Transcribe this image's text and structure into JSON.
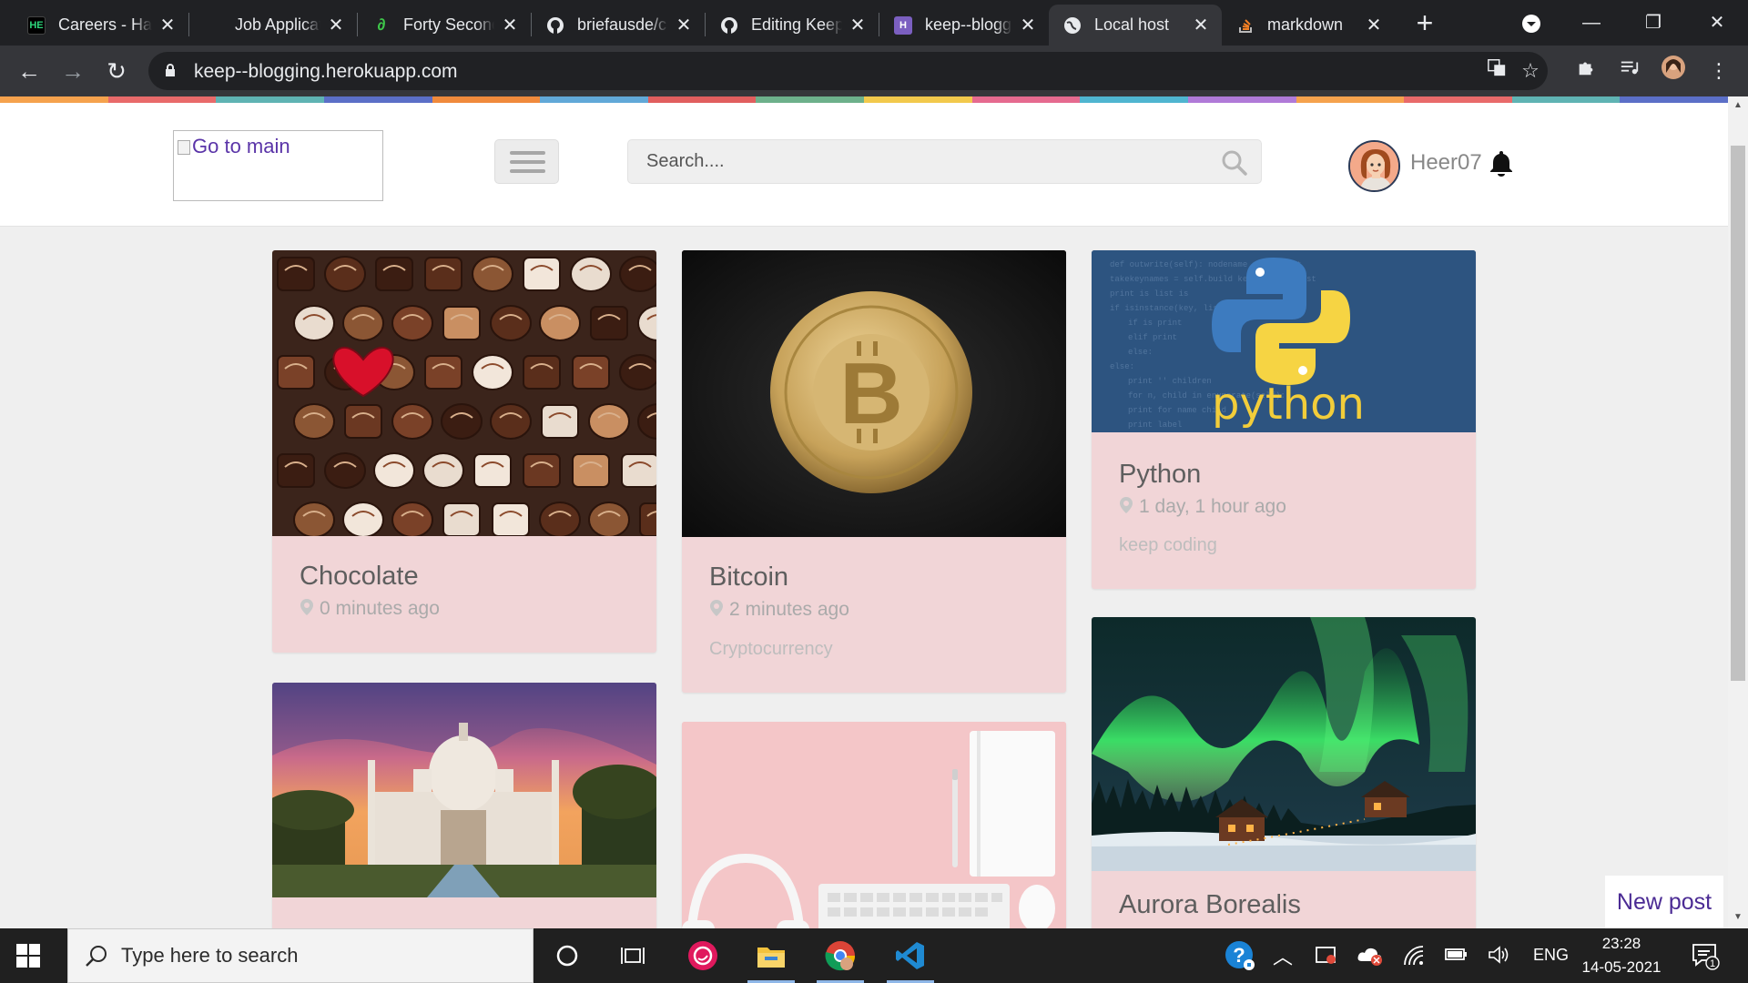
{
  "browser": {
    "tabs": [
      {
        "title": "Careers - Ha",
        "favicon": "hackerearth-favicon",
        "active": false
      },
      {
        "title": "Job Applicat",
        "favicon": "blank-favicon",
        "active": false
      },
      {
        "title": "Forty Second",
        "favicon": "fortyseconds-favicon",
        "active": false
      },
      {
        "title": "briefausde/c",
        "favicon": "github-favicon",
        "active": false
      },
      {
        "title": "Editing Keep",
        "favicon": "github-favicon",
        "active": false
      },
      {
        "title": "keep--blogg",
        "favicon": "heroku-favicon",
        "active": false
      },
      {
        "title": "Local host",
        "favicon": "globe-favicon",
        "active": true
      },
      {
        "title": "markdown",
        "favicon": "stackoverflow-favicon",
        "active": false
      }
    ],
    "url": "keep--blogging.herokuapp.com"
  },
  "site": {
    "logo_alt": "Go to main",
    "search_placeholder": "Search....",
    "username": "Heer07",
    "new_post_label": "New post",
    "stripe_colors": [
      "#f5a24d",
      "#e86a6a",
      "#5fb3b3",
      "#5b6fc7",
      "#f08a3c",
      "#61a8d8",
      "#e05e5e",
      "#6db08b",
      "#f2c94c",
      "#e56a8f",
      "#4fb5d0",
      "#b07ad8",
      "#f5a24d",
      "#e86a6a",
      "#5fb3b3",
      "#5b6fc7"
    ]
  },
  "posts": [
    {
      "title": "Chocolate",
      "time": "0 minutes ago",
      "description": ""
    },
    {
      "title": "Bitcoin",
      "time": "2 minutes ago",
      "description": "Cryptocurrency"
    },
    {
      "title": "Python",
      "time": "1 day, 1 hour ago",
      "description": "keep coding"
    },
    {
      "title": "Aurora Borealis",
      "time": "",
      "description": ""
    },
    {
      "title": "",
      "time": "",
      "description": ""
    },
    {
      "title": "",
      "time": "",
      "description": ""
    }
  ],
  "taskbar": {
    "search_placeholder": "Type here to search",
    "language": "ENG",
    "time": "23:28",
    "date": "14-05-2021",
    "notification_count": "1"
  }
}
